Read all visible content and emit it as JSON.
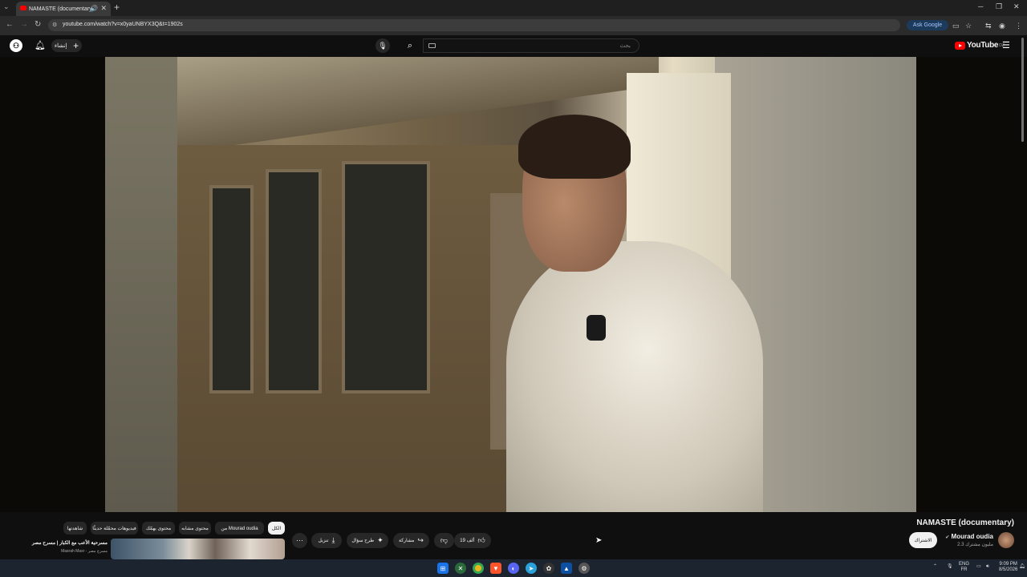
{
  "browser": {
    "tab_title": "NAMASTE (documentary)",
    "url": "youtube.com/watch?v=x0yaUNBYX3Q&t=1902s",
    "ask_google": "Ask Google"
  },
  "header": {
    "create_label": "إنشاء",
    "search_placeholder": "بحث",
    "logo_text": "YouTube",
    "logo_country": "DZ"
  },
  "video": {
    "title": "NAMASTE (documentary)",
    "channel_name": "Mourad oudia",
    "subscribers": "2.3 مليون مشترك",
    "subscribe_label": "الاشتراك",
    "likes": "19 ألف",
    "share_label": "مشاركة",
    "ask_label": "طرح سؤال",
    "download_label": "تنزيل"
  },
  "chips": [
    {
      "label": "الكل",
      "active": true
    },
    {
      "label": "من Mourad oudia",
      "active": false
    },
    {
      "label": "محتوى مشابه",
      "active": false
    },
    {
      "label": "محتوى يهمّك",
      "active": false
    },
    {
      "label": "فيديوهات محمّلة حديثًا",
      "active": false
    },
    {
      "label": "شاهدتها",
      "active": false
    }
  ],
  "recommendation": {
    "title": "مسرحية الأعب مع الكبار | مسرح مصر",
    "channel": "Masrah Masr - مسرح مصر"
  },
  "tray": {
    "lang_top": "ENG",
    "lang_bottom": "FR",
    "time": "9:09 PM",
    "date": "8/5/2026"
  },
  "colors": {
    "youtube_red": "#ff0000",
    "background": "#0f0f0f",
    "pill": "#272727"
  }
}
